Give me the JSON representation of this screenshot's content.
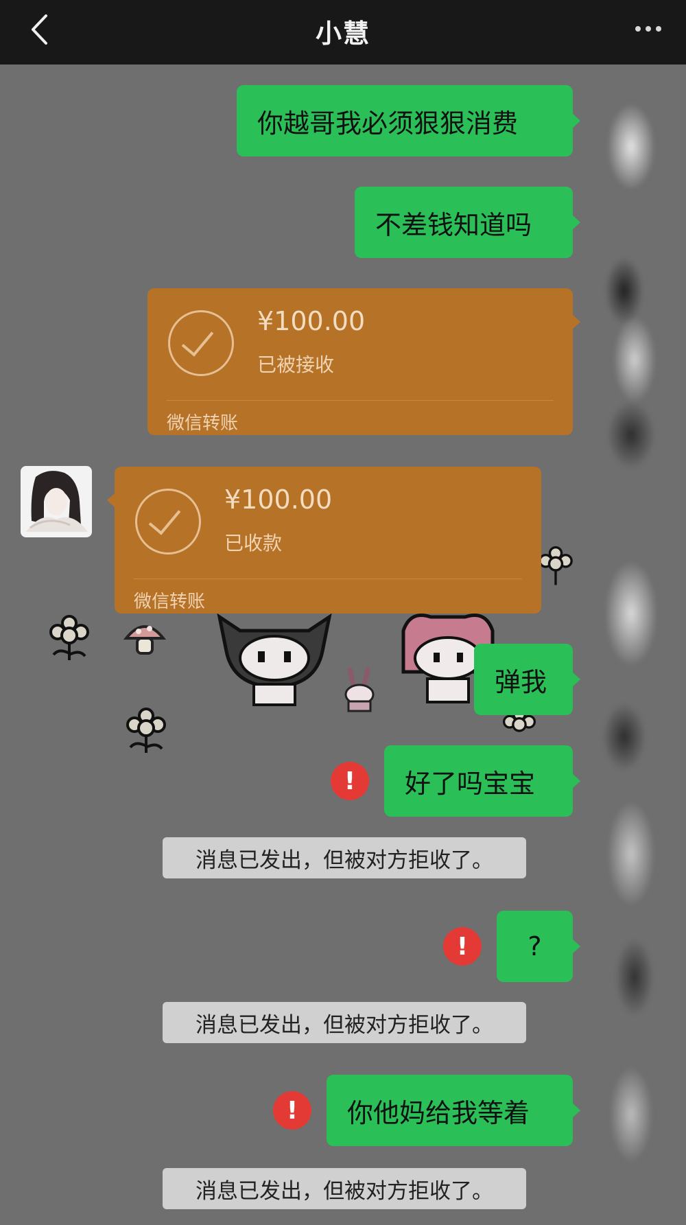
{
  "header": {
    "title": "小慧",
    "back_icon": "chevron-left-icon",
    "more_icon": "more-dots-icon"
  },
  "colors": {
    "accent_green": "#2bbf58",
    "transfer_orange": "#b67328",
    "error_red": "#e43a35",
    "background": "#6f6f6f"
  },
  "messages": {
    "m1": "你越哥我必须狠狠消费",
    "m2": "不差钱知道吗",
    "m3": "弹我",
    "m4": "好了吗宝宝",
    "m5": "?",
    "m6": "你他妈给我等着"
  },
  "transfer_sent": {
    "amount": "¥100.00",
    "status": "已被接收",
    "label": "微信转账"
  },
  "transfer_received": {
    "amount": "¥100.00",
    "status": "已收款",
    "label": "微信转账"
  },
  "error_mark": "!",
  "notices": {
    "n1": "消息已发出，但被对方拒收了。",
    "n2": "消息已发出，但被对方拒收了。",
    "n3": "消息已发出，但被对方拒收了。"
  }
}
